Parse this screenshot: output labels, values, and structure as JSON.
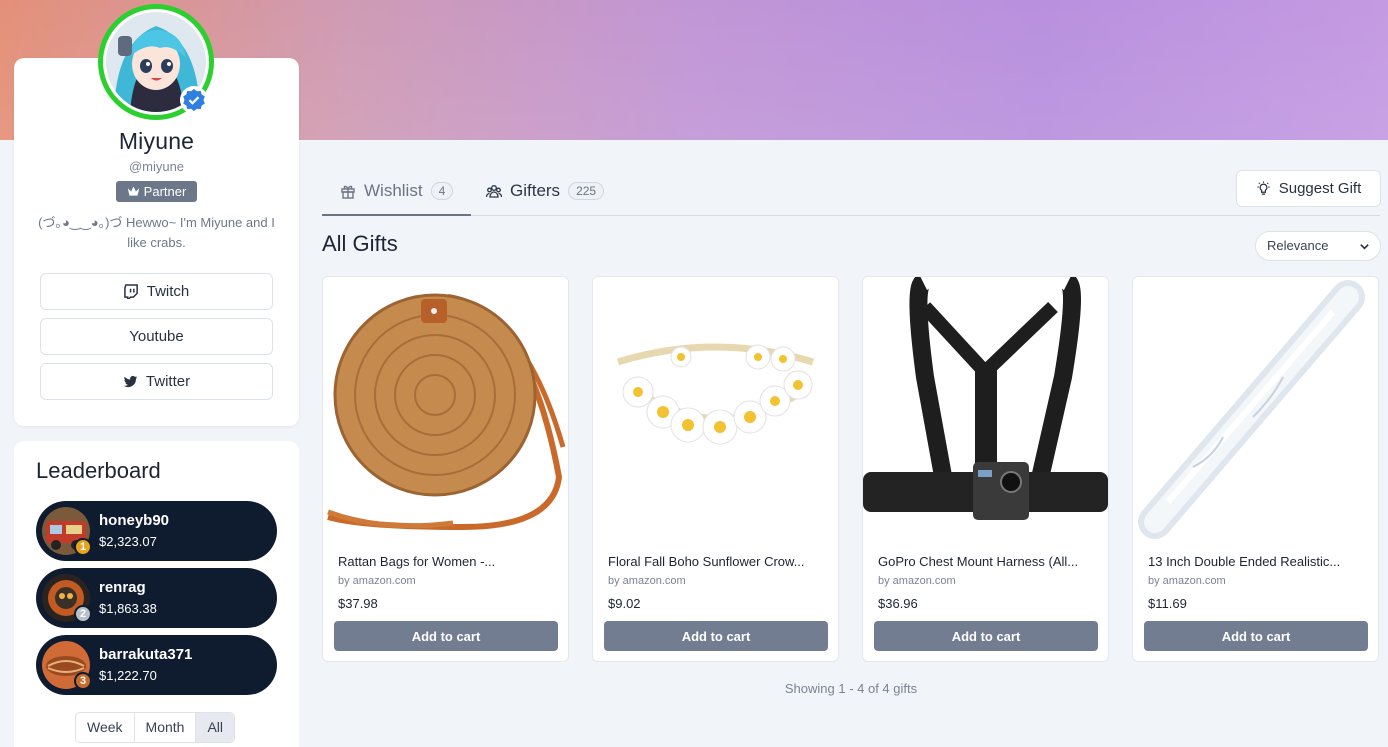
{
  "profile": {
    "display_name": "Miyune",
    "handle": "@miyune",
    "badge": "Partner",
    "bio": "(づ｡◕‿‿◕｡)づ Hewwo~ I'm Miyune and I like crabs.",
    "links": [
      {
        "label": "Twitch",
        "icon": "twitch-icon"
      },
      {
        "label": "Youtube",
        "icon": ""
      },
      {
        "label": "Twitter",
        "icon": "twitter-icon"
      }
    ],
    "ring_color": "#2ad02e",
    "verified_color": "#2f7fe0"
  },
  "leaderboard": {
    "title": "Leaderboard",
    "entries": [
      {
        "rank": "1",
        "name": "honeyb90",
        "amount": "$2,323.07",
        "badge_color": "#e9a21c"
      },
      {
        "rank": "2",
        "name": "renrag",
        "amount": "$1,863.38",
        "badge_color": "#b9c0cc"
      },
      {
        "rank": "3",
        "name": "barrakuta371",
        "amount": "$1,222.70",
        "badge_color": "#c96a2b"
      }
    ],
    "periods": [
      "Week",
      "Month",
      "All"
    ],
    "selected_period": "All"
  },
  "tabs": [
    {
      "label": "Wishlist",
      "count": "4",
      "icon": "gift-icon",
      "active": true
    },
    {
      "label": "Gifters",
      "count": "225",
      "icon": "users-icon",
      "active": false
    }
  ],
  "suggest_label": "Suggest Gift",
  "section_title": "All Gifts",
  "sort_label": "Relevance",
  "products": [
    {
      "title": "Rattan Bags for Women -...",
      "seller": "by amazon.com",
      "price": "$37.98",
      "cart": "Add to cart"
    },
    {
      "title": "Floral Fall Boho Sunflower Crow...",
      "seller": "by amazon.com",
      "price": "$9.02",
      "cart": "Add to cart"
    },
    {
      "title": "GoPro Chest Mount Harness (All...",
      "seller": "by amazon.com",
      "price": "$36.96",
      "cart": "Add to cart"
    },
    {
      "title": "13 Inch Double Ended Realistic...",
      "seller": "by amazon.com",
      "price": "$11.69",
      "cart": "Add to cart"
    }
  ],
  "showing_text": "Showing 1 - 4 of 4 gifts"
}
